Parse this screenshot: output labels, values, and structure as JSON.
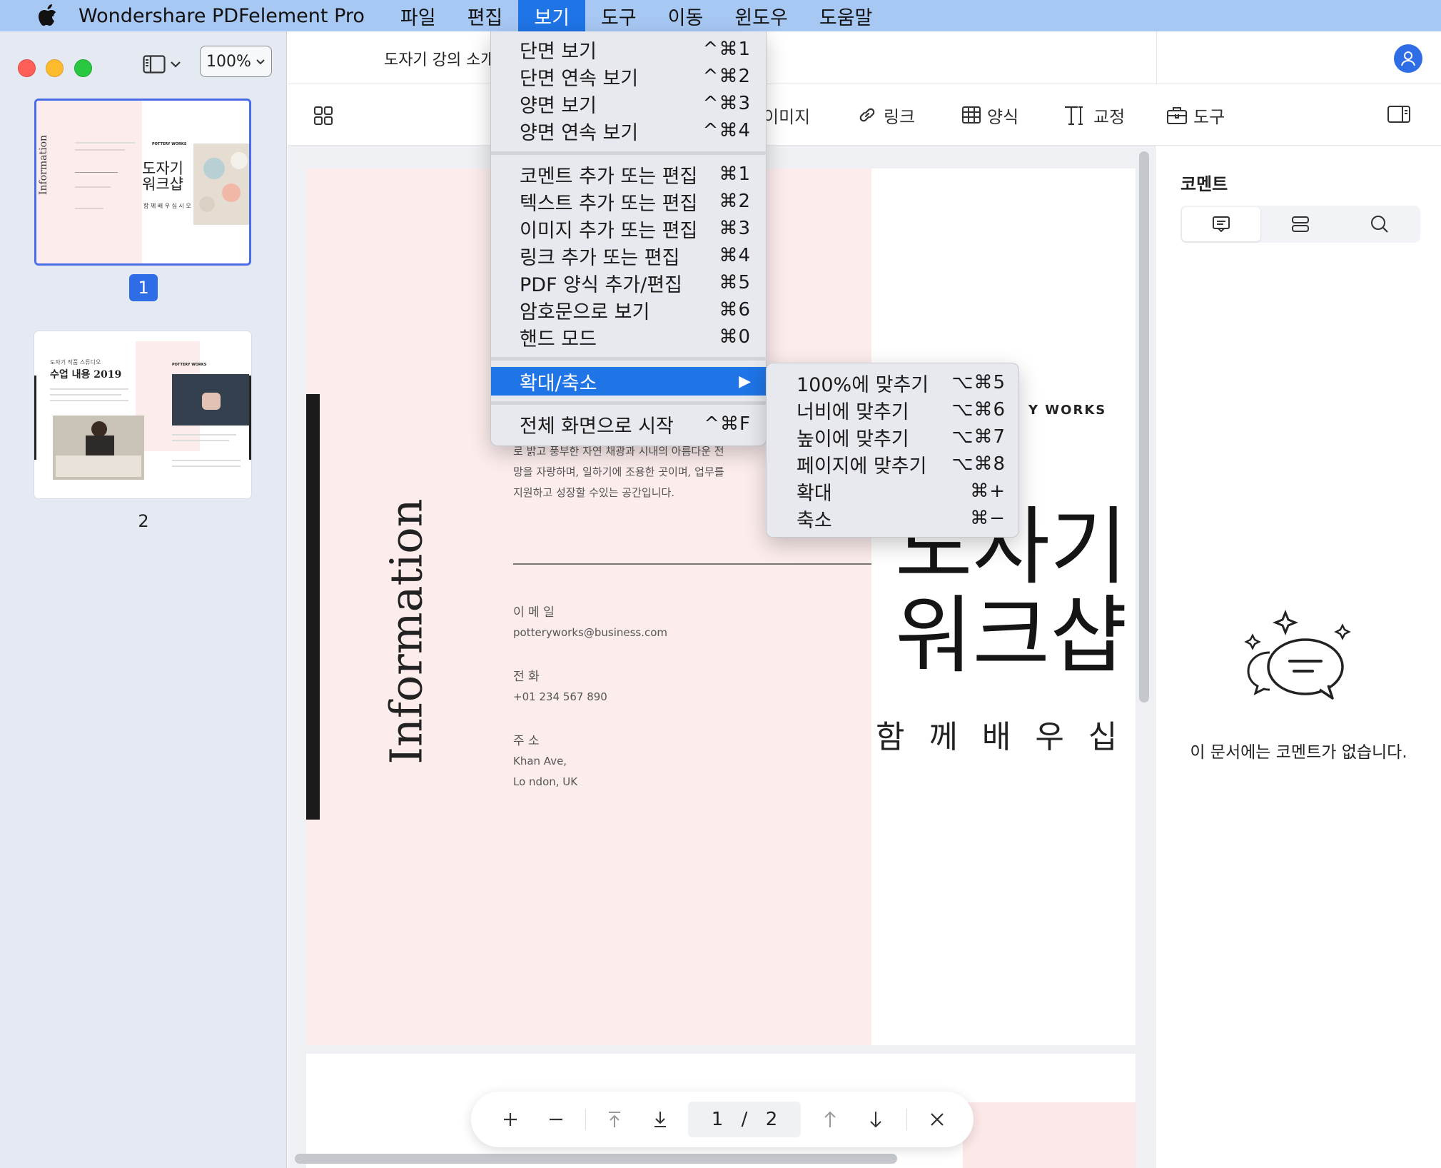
{
  "menubar": {
    "app_name": "Wondershare PDFelement Pro",
    "menus": [
      "파일",
      "편집",
      "보기",
      "도구",
      "이동",
      "윈도우",
      "도움말"
    ],
    "active_menu": "보기"
  },
  "sidebar": {
    "zoom": "100%",
    "pages": [
      {
        "label": "1",
        "selected": true,
        "thumb_title": "도자기\n워크샵",
        "thumb_vertical": "Information",
        "thumb_sub": "함 께 배 우 십 시 오",
        "thumb_brand": "POTTERY WORKS"
      },
      {
        "label": "2",
        "selected": false,
        "thumb_title": "수업 내용 2019",
        "thumb_kicker": "도자기 작품 스튜디오",
        "thumb_brand": "POTTERY WORKS"
      }
    ]
  },
  "document_tab": "도자기 강의 소개",
  "toolbar": {
    "items": [
      {
        "label": "이미지",
        "icon": "image-icon"
      },
      {
        "label": "링크",
        "icon": "link-icon"
      },
      {
        "label": "양식",
        "icon": "table-icon"
      },
      {
        "label": "교정",
        "icon": "redact-icon"
      },
      {
        "label": "도구",
        "icon": "toolbox-icon"
      }
    ]
  },
  "page": {
    "vertical_heading": "Information",
    "body_lines": [
      "로 밝고 풍부한 자연 채광과 시내의 아름다운 전",
      "망을 자랑하며, 일하기에 조용한 곳이며, 업무를",
      "지원하고 성장할 수있는 공간입니다."
    ],
    "email_label": "이 메 일",
    "email": "potteryworks@business.com",
    "phone_label": "전 화",
    "phone": "+01 234 567 890",
    "address_label": "주 소",
    "address_line1": "Khan Ave,",
    "address_line2": "Lo ndon, UK",
    "brand": "Y WORKS",
    "title_line1": "도자기",
    "title_line2": "워크샵",
    "subtitle": "함 께 배 우 십 시 오"
  },
  "pagenav": {
    "current": "1",
    "separator": "/",
    "total": "2"
  },
  "comments": {
    "title": "코멘트",
    "empty_text": "이 문서에는 코멘트가 없습니다."
  },
  "view_menu": {
    "group1": [
      {
        "label": "단면 보기",
        "shortcut": "^⌘1"
      },
      {
        "label": "단면 연속 보기",
        "shortcut": "^⌘2"
      },
      {
        "label": "양면 보기",
        "shortcut": "^⌘3"
      },
      {
        "label": "양면 연속 보기",
        "shortcut": "^⌘4"
      }
    ],
    "group2": [
      {
        "label": "코멘트 추가 또는 편집",
        "shortcut": "⌘1"
      },
      {
        "label": "텍스트 추가 또는 편집",
        "shortcut": "⌘2"
      },
      {
        "label": "이미지 추가 또는 편집",
        "shortcut": "⌘3"
      },
      {
        "label": "링크 추가 또는 편집",
        "shortcut": "⌘4"
      },
      {
        "label": "PDF 양식 추가/편집",
        "shortcut": "⌘5"
      },
      {
        "label": "암호문으로 보기",
        "shortcut": "⌘6"
      },
      {
        "label": "핸드 모드",
        "shortcut": "⌘0"
      }
    ],
    "zoom_item": {
      "label": "확대/축소",
      "arrow": "▶"
    },
    "fullscreen": {
      "label": "전체 화면으로 시작",
      "shortcut": "^⌘F"
    }
  },
  "zoom_submenu": [
    {
      "label": "100%에 맞추기",
      "shortcut": "⌥⌘5"
    },
    {
      "label": "너비에 맞추기",
      "shortcut": "⌥⌘6"
    },
    {
      "label": "높이에 맞추기",
      "shortcut": "⌥⌘7"
    },
    {
      "label": "페이지에 맞추기",
      "shortcut": "⌥⌘8"
    },
    {
      "label": "확대",
      "shortcut": "⌘+"
    },
    {
      "label": "축소",
      "shortcut": "⌘−"
    }
  ],
  "colors": {
    "accent": "#1f74e6",
    "menubar": "#a8c8f4",
    "pink": "#fcecec"
  }
}
